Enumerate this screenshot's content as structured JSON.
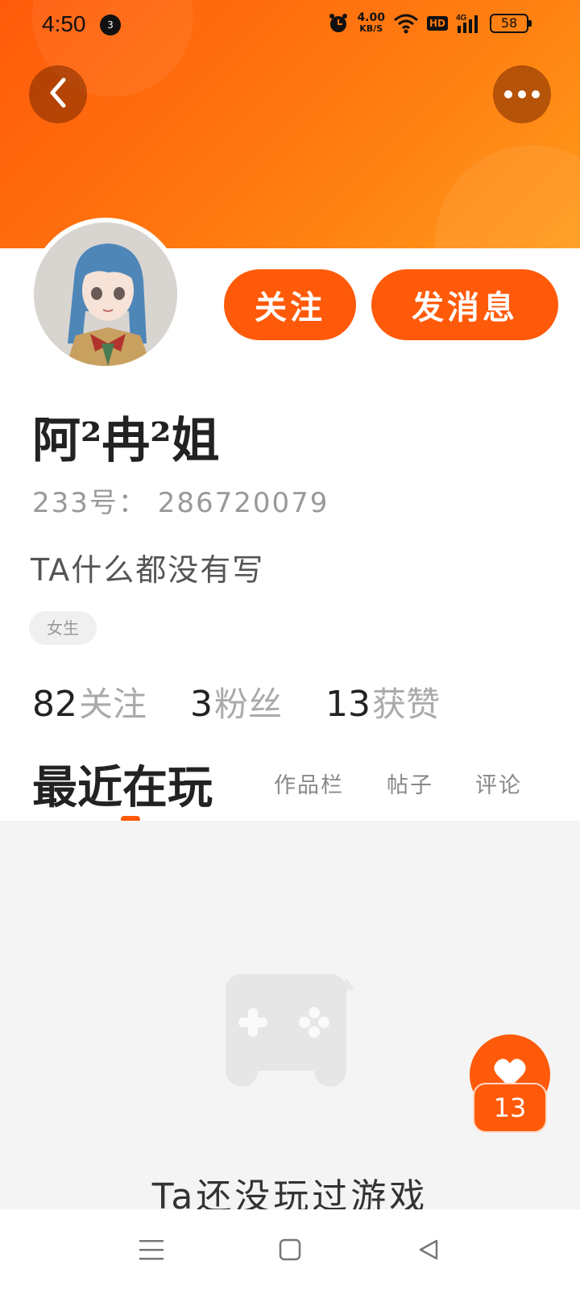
{
  "status_bar": {
    "time": "4:50",
    "notification_count": "3",
    "net_speed_value": "4.00",
    "net_speed_unit": "KB/S",
    "hd_label": "HD",
    "network_label": "4G",
    "battery_level": "58",
    "icons": [
      "alarm-icon",
      "wifi-icon",
      "signal-icon",
      "battery-icon"
    ]
  },
  "header": {
    "back_icon": "chevron-left-icon",
    "more_icon": "more-horizontal-icon",
    "accent_color": "#ff5a0a"
  },
  "profile": {
    "username": "阿²冉²姐",
    "user_id": "233号：  286720079",
    "bio": "TA什么都没有写",
    "tag": "女生",
    "follow_button": "关注",
    "message_button": "发消息"
  },
  "stats": [
    {
      "value": "82",
      "label": "关注"
    },
    {
      "value": "3",
      "label": "粉丝"
    },
    {
      "value": "13",
      "label": "获赞"
    }
  ],
  "tabs": {
    "active": "最近在玩",
    "items": [
      "作品栏",
      "帖子",
      "评论"
    ]
  },
  "content": {
    "empty_icon": "gamepad-icon",
    "empty_text": "Ta还没玩过游戏"
  },
  "like_fab": {
    "icon": "heart-icon",
    "count": "13"
  },
  "nav_bar": {
    "icons": [
      "menu-icon",
      "home-square-icon",
      "back-triangle-icon"
    ]
  }
}
